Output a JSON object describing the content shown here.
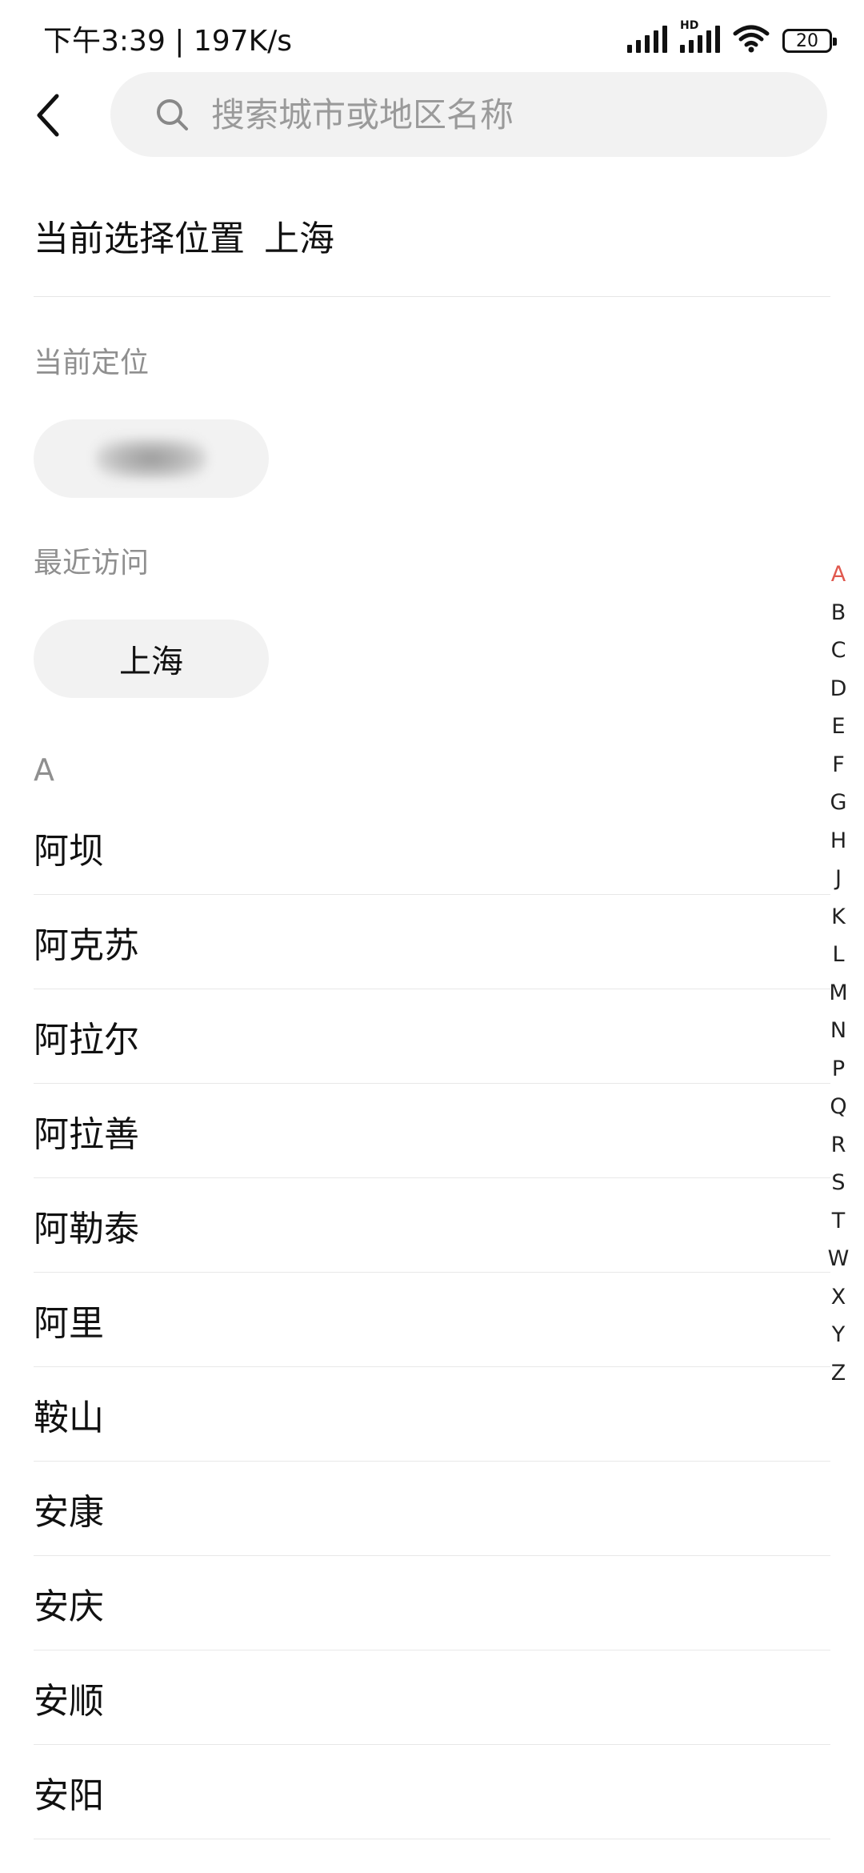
{
  "status_bar": {
    "time_speed": "下午3:39 | 197K/s",
    "hd_label": "HD",
    "battery": "20"
  },
  "search": {
    "placeholder": "搜索城市或地区名称",
    "value": ""
  },
  "current_selection": {
    "label": "当前选择位置",
    "city": "上海"
  },
  "current_location": {
    "label": "当前定位"
  },
  "recent": {
    "label": "最近访问",
    "items": [
      "上海"
    ]
  },
  "list": {
    "letter": "A",
    "cities": [
      "阿坝",
      "阿克苏",
      "阿拉尔",
      "阿拉善",
      "阿勒泰",
      "阿里",
      "鞍山",
      "安康",
      "安庆",
      "安顺",
      "安阳"
    ]
  },
  "index_bar": {
    "letters": [
      "A",
      "B",
      "C",
      "D",
      "E",
      "F",
      "G",
      "H",
      "J",
      "K",
      "L",
      "M",
      "N",
      "P",
      "Q",
      "R",
      "S",
      "T",
      "W",
      "X",
      "Y",
      "Z"
    ],
    "active": "A",
    "active_color": "#e0584e"
  }
}
